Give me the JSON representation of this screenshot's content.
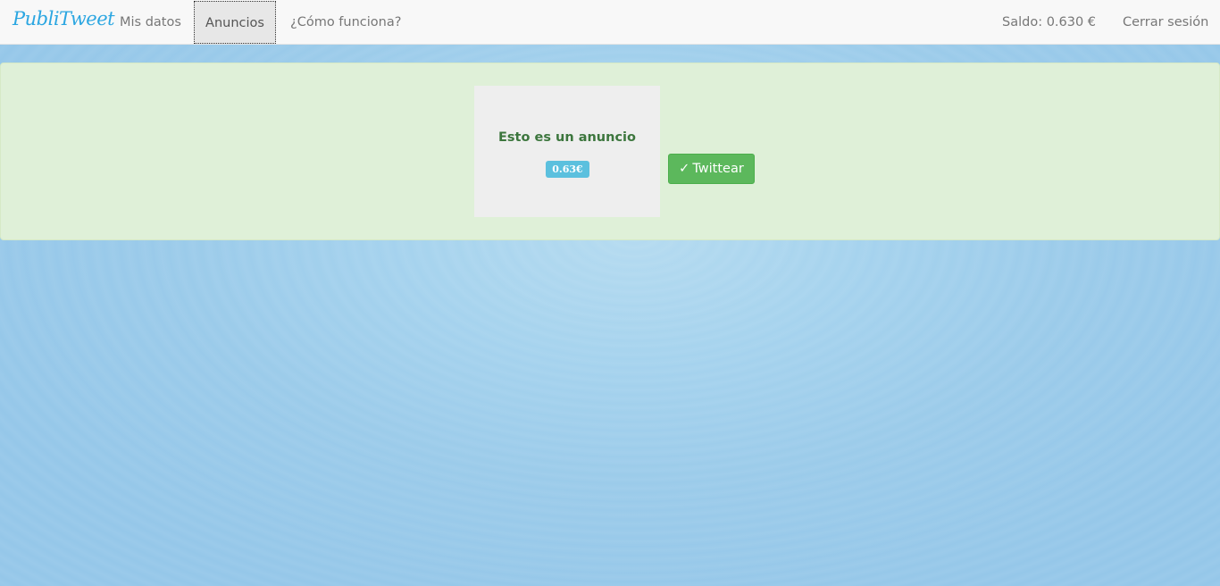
{
  "navbar": {
    "brand": "PubliTweet",
    "items": [
      {
        "label": "Mis datos"
      },
      {
        "label": "Anuncios",
        "active": true
      },
      {
        "label": "¿Cómo funciona?"
      }
    ],
    "balance": "Saldo: 0.630 €",
    "logout": "Cerrar sesión"
  },
  "ad": {
    "title": "Esto es un anuncio",
    "price": "0.63€"
  },
  "tweet_button": {
    "icon": "check-icon",
    "icon_glyph": "✓",
    "label": "Twittear"
  },
  "colors": {
    "brand": "#2ba6e1",
    "background": "#95c8e9",
    "alert_bg": "#dff0d8",
    "success": "#5cb85c",
    "info": "#5bc0de"
  }
}
